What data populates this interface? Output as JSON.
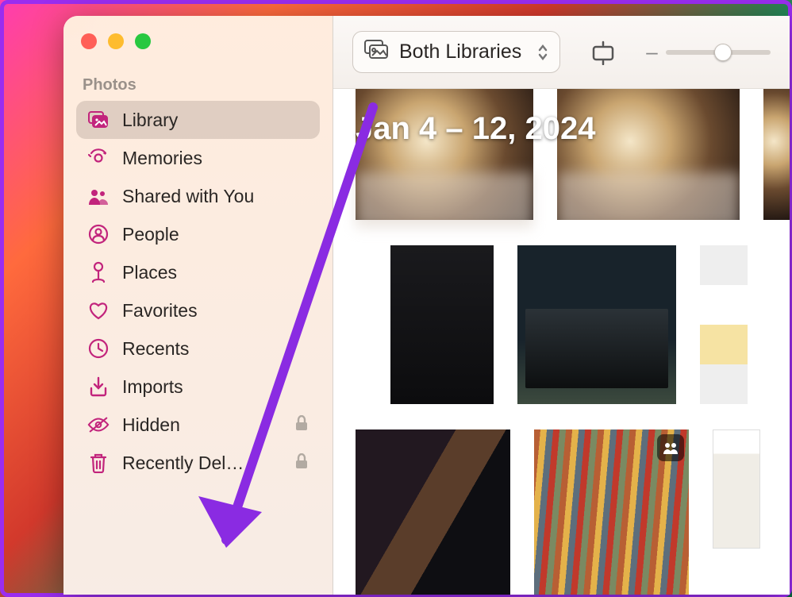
{
  "sidebar": {
    "section": "Photos",
    "items": [
      {
        "label": "Library",
        "icon": "library",
        "selected": true,
        "locked": false
      },
      {
        "label": "Memories",
        "icon": "memories",
        "selected": false,
        "locked": false
      },
      {
        "label": "Shared with You",
        "icon": "shared",
        "selected": false,
        "locked": false
      },
      {
        "label": "People",
        "icon": "people",
        "selected": false,
        "locked": false
      },
      {
        "label": "Places",
        "icon": "places",
        "selected": false,
        "locked": false
      },
      {
        "label": "Favorites",
        "icon": "favorites",
        "selected": false,
        "locked": false
      },
      {
        "label": "Recents",
        "icon": "recents",
        "selected": false,
        "locked": false
      },
      {
        "label": "Imports",
        "icon": "imports",
        "selected": false,
        "locked": false
      },
      {
        "label": "Hidden",
        "icon": "hidden",
        "selected": false,
        "locked": true
      },
      {
        "label": "Recently Del…",
        "icon": "trash",
        "selected": false,
        "locked": true
      }
    ]
  },
  "toolbar": {
    "library_selector": "Both Libraries",
    "slider_value": 0.55
  },
  "content": {
    "date_range": "Jan 4 – 12, 2024"
  },
  "traffic": {
    "close": "#ff5f57",
    "min": "#febc2e",
    "max": "#28c840"
  },
  "accent": "#c2247c",
  "annotation_arrow_color": "#8a2be2"
}
